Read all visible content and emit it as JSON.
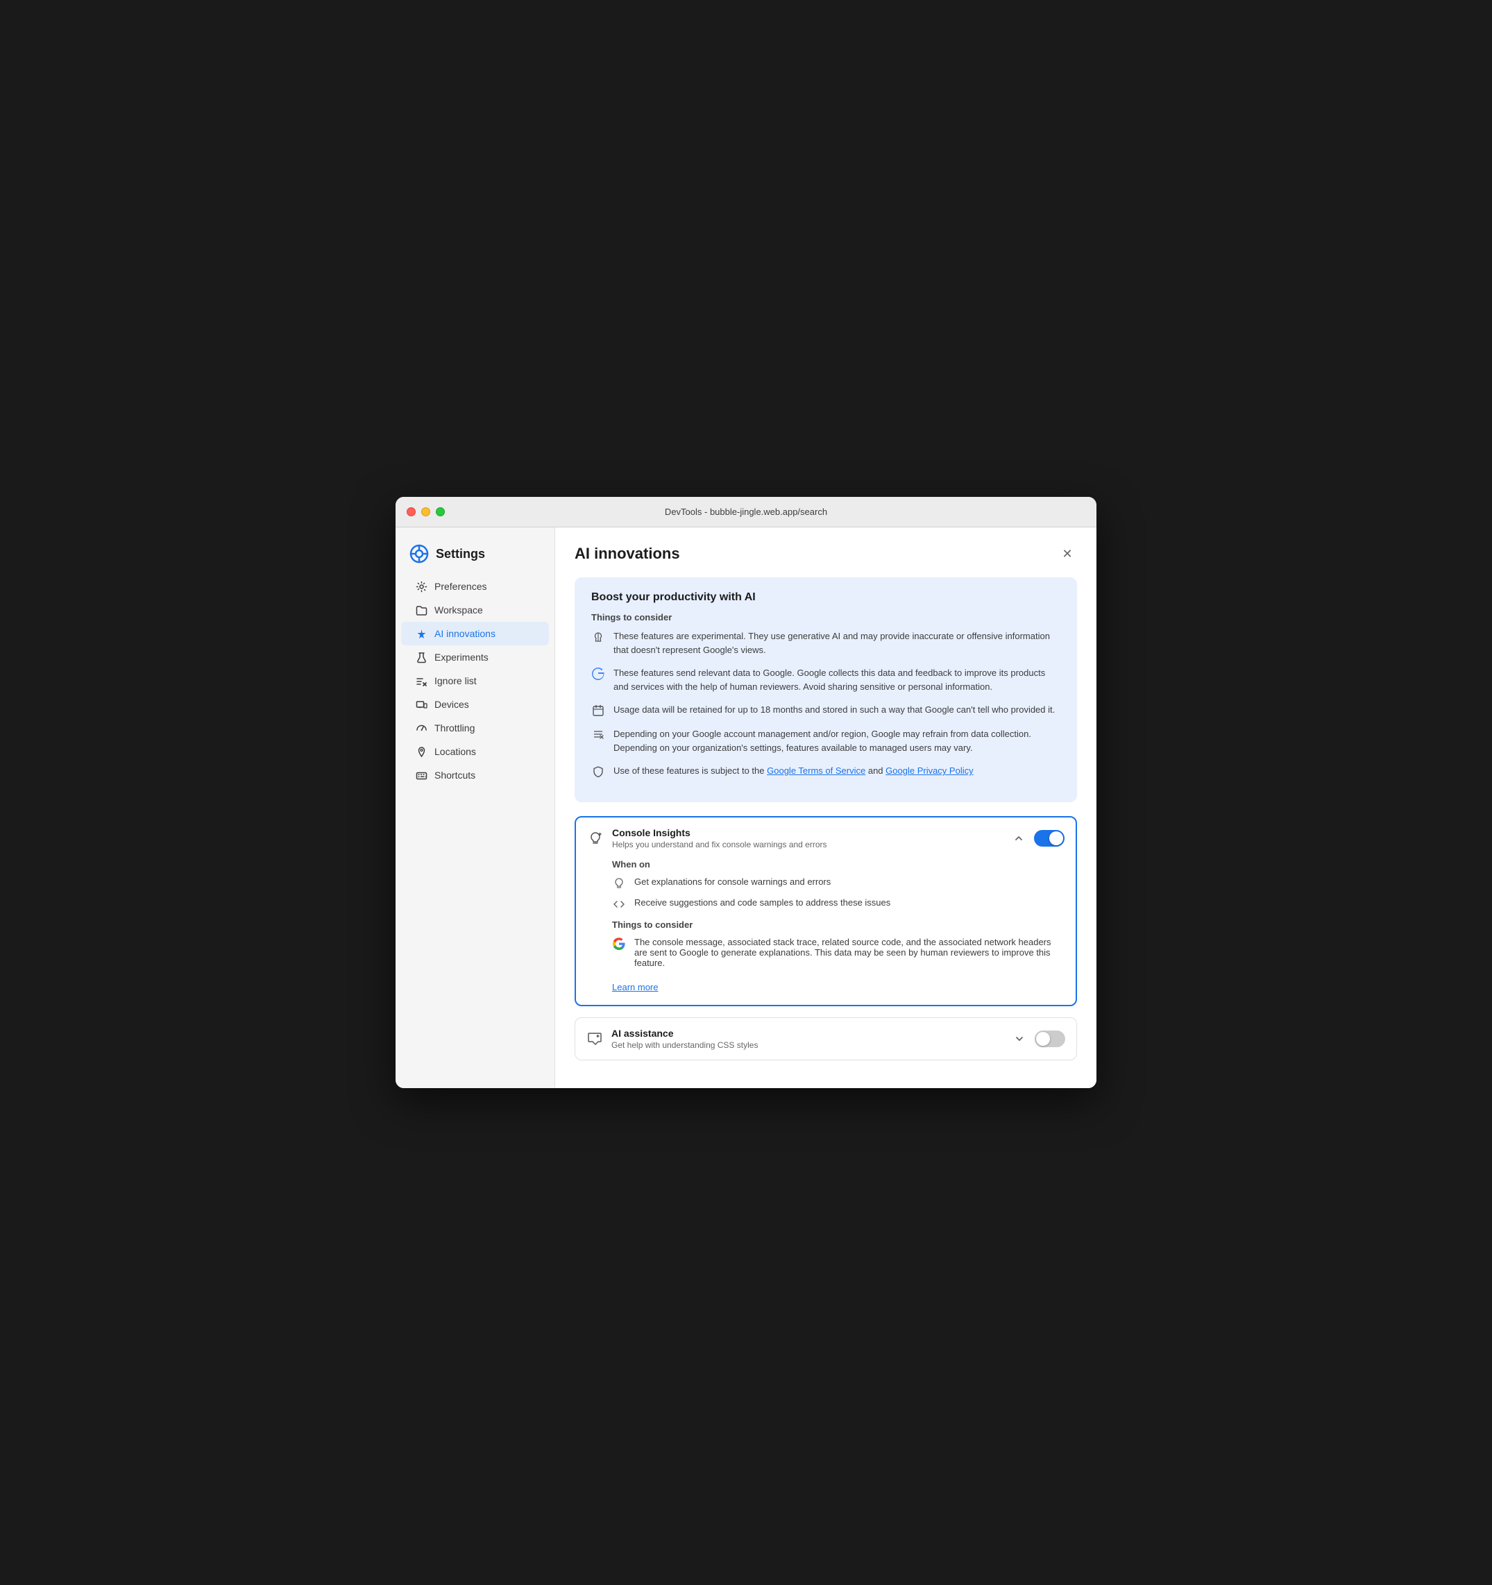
{
  "window": {
    "title": "DevTools - bubble-jingle.web.app/search"
  },
  "sidebar": {
    "heading": "Settings",
    "items": [
      {
        "id": "preferences",
        "label": "Preferences",
        "icon": "gear"
      },
      {
        "id": "workspace",
        "label": "Workspace",
        "icon": "folder"
      },
      {
        "id": "ai-innovations",
        "label": "AI innovations",
        "icon": "sparkle",
        "active": true
      },
      {
        "id": "experiments",
        "label": "Experiments",
        "icon": "flask"
      },
      {
        "id": "ignore-list",
        "label": "Ignore list",
        "icon": "list-x"
      },
      {
        "id": "devices",
        "label": "Devices",
        "icon": "devices"
      },
      {
        "id": "throttling",
        "label": "Throttling",
        "icon": "speedometer"
      },
      {
        "id": "locations",
        "label": "Locations",
        "icon": "pin"
      },
      {
        "id": "shortcuts",
        "label": "Shortcuts",
        "icon": "keyboard"
      }
    ]
  },
  "content": {
    "title": "AI innovations",
    "info_card": {
      "heading": "Boost your productivity with AI",
      "things_label": "Things to consider",
      "items": [
        {
          "icon": "brain",
          "text": "These features are experimental. They use generative AI and may provide inaccurate or offensive information that doesn't represent Google's views."
        },
        {
          "icon": "google",
          "text": "These features send relevant data to Google. Google collects this data and feedback to improve its products and services with the help of human reviewers. Avoid sharing sensitive or personal information."
        },
        {
          "icon": "calendar",
          "text": "Usage data will be retained for up to 18 months and stored in such a way that Google can't tell who provided it."
        },
        {
          "icon": "list",
          "text": "Depending on your Google account management and/or region, Google may refrain from data collection. Depending on your organization's settings, features available to managed users may vary."
        },
        {
          "icon": "shield",
          "text_prefix": "Use of these features is subject to the ",
          "link1_text": "Google Terms of Service",
          "link1_href": "#",
          "text_middle": " and ",
          "link2_text": "Google Privacy Policy",
          "link2_href": "#",
          "text_suffix": ""
        }
      ]
    },
    "features": [
      {
        "id": "console-insights",
        "icon": "lightbulb-plus",
        "name": "Console Insights",
        "desc": "Helps you understand and fix console warnings and errors",
        "expanded": true,
        "enabled": true,
        "when_on_label": "When on",
        "benefits": [
          {
            "icon": "lightbulb",
            "text": "Get explanations for console warnings and errors"
          },
          {
            "icon": "code",
            "text": "Receive suggestions and code samples to address these issues"
          }
        ],
        "things_label": "Things to consider",
        "considerations": [
          {
            "icon": "google",
            "text": "The console message, associated stack trace, related source code, and the associated network headers are sent to Google to generate explanations. This data may be seen by human reviewers to improve this feature."
          }
        ],
        "learn_more_text": "Learn more",
        "learn_more_href": "#"
      },
      {
        "id": "ai-assistance",
        "icon": "chat-plus",
        "name": "AI assistance",
        "desc": "Get help with understanding CSS styles",
        "expanded": false,
        "enabled": false
      }
    ]
  }
}
